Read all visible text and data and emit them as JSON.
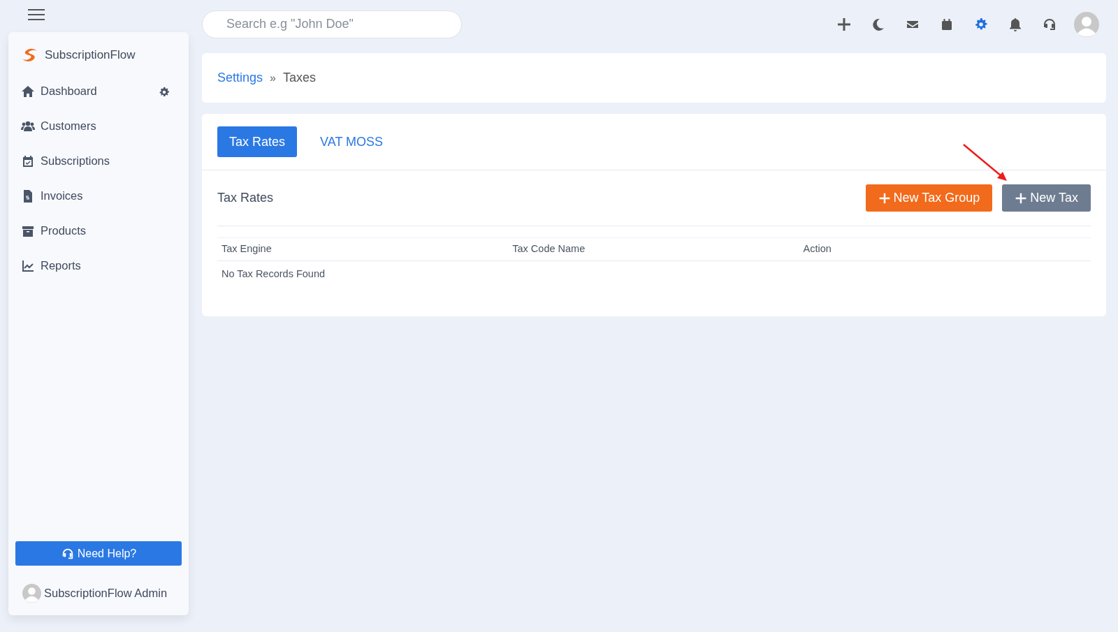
{
  "sidebar": {
    "brand": "SubscriptionFlow",
    "items": [
      {
        "label": "Dashboard",
        "gear": true
      },
      {
        "label": "Customers",
        "gear": false
      },
      {
        "label": "Subscriptions",
        "gear": false
      },
      {
        "label": "Invoices",
        "gear": false
      },
      {
        "label": "Products",
        "gear": false
      },
      {
        "label": "Reports",
        "gear": false
      }
    ],
    "help_button": "Need Help?",
    "user": "SubscriptionFlow Admin"
  },
  "topbar": {
    "search": {
      "placeholder": "Search e.g \"John Doe\""
    },
    "icons": [
      {
        "selected": false
      },
      {
        "selected": false
      },
      {
        "selected": false
      },
      {
        "selected": false
      },
      {
        "selected": true
      },
      {
        "selected": false
      },
      {
        "selected": false
      }
    ]
  },
  "breadcrumb": [
    {
      "label": "Settings",
      "link": true
    },
    {
      "label": "Taxes",
      "link": false
    }
  ],
  "breadcrumb_separator": "»",
  "tabs": [
    {
      "label": "Tax Rates",
      "selected": true
    },
    {
      "label": "VAT MOSS",
      "selected": false
    }
  ],
  "section_title": "Tax Rates",
  "buttons": [
    {
      "label": "New Tax Group",
      "kind": "orange"
    },
    {
      "label": "New Tax",
      "kind": "grey"
    }
  ],
  "table": {
    "columns": [
      "Tax Engine",
      "Tax Code Name",
      "Action"
    ],
    "empty_message": "No Tax Records Found"
  }
}
